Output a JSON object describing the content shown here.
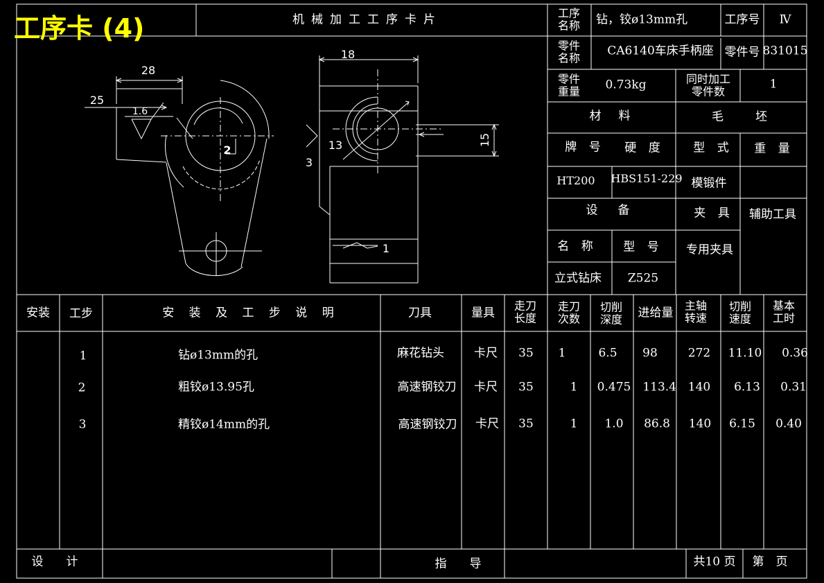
{
  "overlay_title": "工序卡 (4)",
  "header": {
    "card_title": "机械加工工序卡片",
    "process_name_label": "工序\n名称",
    "process_name": "钻，铰ø13mm孔",
    "process_no_label": "工序号",
    "process_no": "Ⅳ",
    "part_name_label": "零件\n名称",
    "part_name": "CA6140车床手柄座",
    "part_no_label": "零件号",
    "part_no": "831015",
    "part_weight_label": "零件\n重量",
    "part_weight": "0.73kg",
    "simul_label": "同时加工\n零件数",
    "simul_value": "1",
    "material_label": "材　料",
    "blank_label": "毛　　坯",
    "grade_label": "牌 号",
    "hardness_label": "硬 度",
    "blank_type_label": "型 式",
    "blank_weight_label": "重 量",
    "grade": "HT200",
    "hardness": "HBS151-229",
    "blank_type": "模锻件",
    "equipment_label": "设　备",
    "fixture_label": "夹 具",
    "aux_tool_label": "辅助工具",
    "eq_name_label": "名 称",
    "eq_model_label": "型 号",
    "fixture_value": "专用夹具",
    "eq_name": "立式钻床",
    "eq_model": "Z525"
  },
  "drawing": {
    "dims": [
      "28",
      "25",
      "1.6",
      "18",
      "13",
      "15"
    ],
    "callouts": [
      "2",
      "3",
      "1"
    ]
  },
  "table": {
    "columns": [
      "安装",
      "工步",
      "安 装 及 工 步 说 明",
      "刀具",
      "量具",
      "走刀\n长度",
      "走刀\n次数",
      "切削\n深度",
      "进给量",
      "主轴\n转速",
      "切削\n速度",
      "基本\n工时"
    ],
    "rows": [
      [
        "",
        "1",
        "钻ø13mm的孔",
        "麻花钻头",
        "卡尺",
        "35",
        "1",
        "6.5",
        "98",
        "272",
        "11.10",
        "0.36"
      ],
      [
        "",
        "2",
        "粗铰ø13.95孔",
        "高速钢铰刀",
        "卡尺",
        "35",
        "1",
        "0.475",
        "113.4",
        "140",
        "6.13",
        "0.31"
      ],
      [
        "",
        "3",
        "精铰ø14mm的孔",
        "高速钢铰刀",
        "卡尺",
        "35",
        "1",
        "1.0",
        "86.8",
        "140",
        "6.15",
        "0.40"
      ]
    ]
  },
  "footer": {
    "design_label": "设　计",
    "guide_label": "指　导",
    "total_pages": "共10 页",
    "page_label": "第　页"
  }
}
